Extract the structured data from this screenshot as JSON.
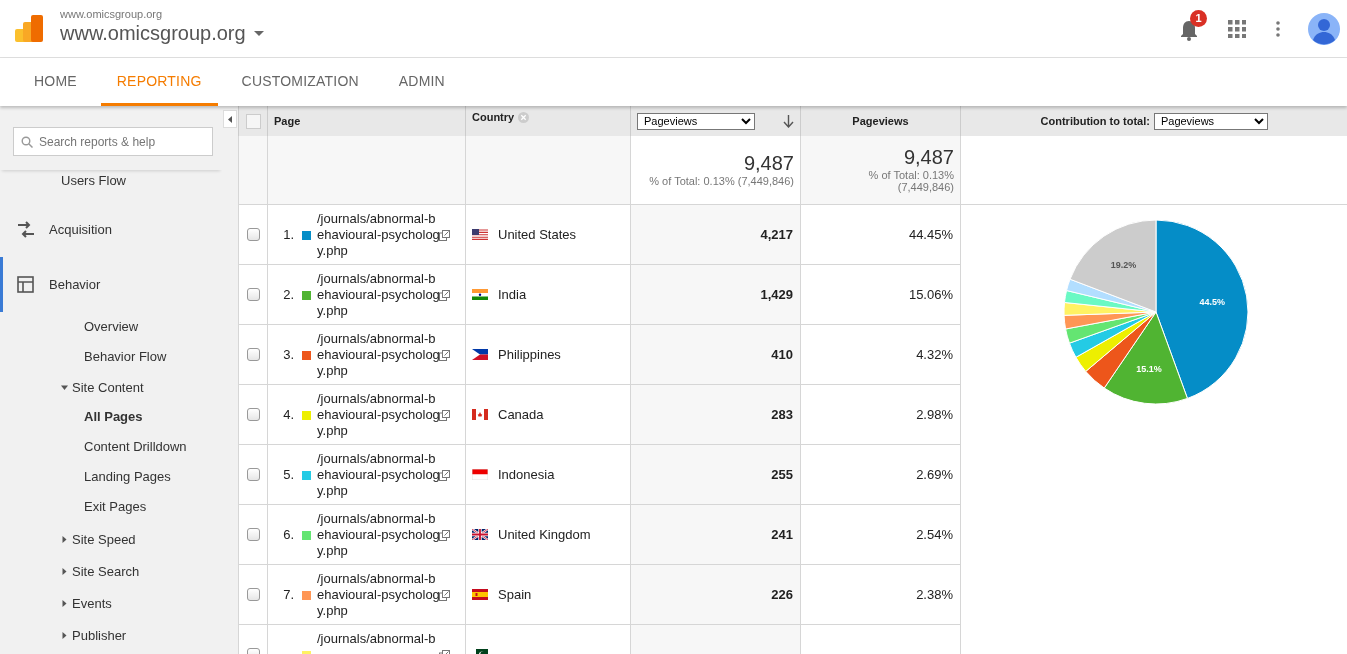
{
  "header": {
    "account": "www.omicsgroup.org",
    "property": "www.omicsgroup.org",
    "notifications": "1"
  },
  "tabs": [
    {
      "label": "HOME",
      "selected": false
    },
    {
      "label": "REPORTING",
      "selected": true
    },
    {
      "label": "CUSTOMIZATION",
      "selected": false
    },
    {
      "label": "ADMIN",
      "selected": false
    }
  ],
  "sidebar": {
    "search": {
      "placeholder": "Search reports & help"
    },
    "items": [
      {
        "label": "Users Flow",
        "kind": "link",
        "selected": false
      },
      {
        "label": "Acquisition",
        "kind": "section",
        "selected": false
      },
      {
        "label": "Behavior",
        "kind": "section",
        "selected": true,
        "children": [
          {
            "label": "Overview",
            "kind": "link",
            "selected": false
          },
          {
            "label": "Behavior Flow",
            "kind": "link",
            "selected": false
          },
          {
            "label": "Site Content",
            "kind": "group",
            "expanded": true,
            "selected": false,
            "children": [
              {
                "label": "All Pages",
                "kind": "link",
                "selected": true
              },
              {
                "label": "Content Drilldown",
                "kind": "link",
                "selected": false
              },
              {
                "label": "Landing Pages",
                "kind": "link",
                "selected": false
              },
              {
                "label": "Exit Pages",
                "kind": "link",
                "selected": false
              }
            ]
          },
          {
            "label": "Site Speed",
            "kind": "group",
            "expanded": false,
            "selected": false
          },
          {
            "label": "Site Search",
            "kind": "group",
            "expanded": false,
            "selected": false
          },
          {
            "label": "Events",
            "kind": "group",
            "expanded": false,
            "selected": false
          },
          {
            "label": "Publisher",
            "kind": "group",
            "expanded": false,
            "selected": false
          }
        ]
      }
    ]
  },
  "table": {
    "all_checked": false,
    "columns": {
      "page": "Page",
      "country": "Country",
      "metric_select": "Pageviews",
      "metric": "Pageviews",
      "contribution_label": "Contribution to total:",
      "contribution_select": "Pageviews"
    },
    "totals": [
      {
        "value": "9,487",
        "note": "% of Total: 0.13% (7,449,846)"
      },
      {
        "value": "9,487",
        "note": "% of Total: 0.13% (7,449,846)"
      }
    ],
    "rows": [
      {
        "checked": false,
        "index": "1.",
        "color": "#058dc7",
        "page": "/journals/abnormal-behavioural-psychology.php",
        "country": "United States",
        "pageviews": "4,217",
        "share": "44.45%"
      },
      {
        "checked": false,
        "index": "2.",
        "color": "#50b432",
        "page": "/journals/abnormal-behavioural-psychology.php",
        "country": "India",
        "pageviews": "1,429",
        "share": "15.06%"
      },
      {
        "checked": false,
        "index": "3.",
        "color": "#ed561b",
        "page": "/journals/abnormal-behavioural-psychology.php",
        "country": "Philippines",
        "pageviews": "410",
        "share": "4.32%"
      },
      {
        "checked": false,
        "index": "4.",
        "color": "#edef00",
        "page": "/journals/abnormal-behavioural-psychology.php",
        "country": "Canada",
        "pageviews": "283",
        "share": "2.98%"
      },
      {
        "checked": false,
        "index": "5.",
        "color": "#24cbe5",
        "page": "/journals/abnormal-behavioural-psychology.php",
        "country": "Indonesia",
        "pageviews": "255",
        "share": "2.69%"
      },
      {
        "checked": false,
        "index": "6.",
        "color": "#64e572",
        "page": "/journals/abnormal-behavioural-psychology.php",
        "country": "United Kingdom",
        "pageviews": "241",
        "share": "2.54%"
      },
      {
        "checked": false,
        "index": "7.",
        "color": "#ff9655",
        "page": "/journals/abnormal-behavioural-psychology.php",
        "country": "Spain",
        "pageviews": "226",
        "share": "2.38%"
      },
      {
        "checked": false,
        "color": "#fff263",
        "page": "/journals/abnormal-b"
      }
    ],
    "chart_data": {
      "type": "pie",
      "values": [
        44.45,
        15.06,
        4.32,
        2.98,
        2.69,
        2.54,
        2.38,
        2.23,
        2.1,
        2.05,
        19.2
      ],
      "colors": [
        "#058dc7",
        "#50b432",
        "#ed561b",
        "#edef00",
        "#24cbe5",
        "#64e572",
        "#ff9655",
        "#fff263",
        "#6af9c4",
        "#b2deff",
        "#cccccc"
      ],
      "value_labels": [
        "44.5%",
        "15.1%",
        null,
        null,
        null,
        null,
        null,
        null,
        null,
        null,
        "19.2%"
      ]
    }
  }
}
